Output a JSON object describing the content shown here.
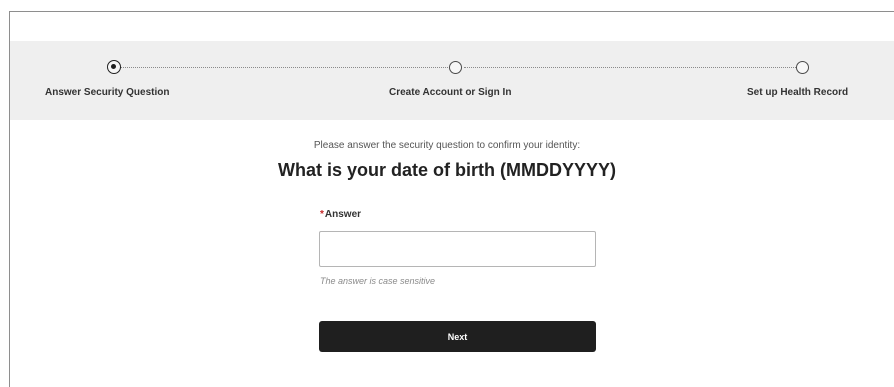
{
  "stepper": {
    "steps": [
      {
        "label": "Answer Security Question",
        "state": "active"
      },
      {
        "label": "Create Account or Sign In",
        "state": "inactive"
      },
      {
        "label": "Set up Health Record",
        "state": "inactive"
      }
    ]
  },
  "form": {
    "intro": "Please answer the security question to confirm your identity:",
    "question": "What is your date of birth (MMDDYYYY)",
    "answer_required_mark": "*",
    "answer_label": "Answer",
    "answer_value": "",
    "answer_placeholder": "",
    "hint": "The answer is case sensitive",
    "next_label": "Next"
  },
  "colors": {
    "required": "#c62828",
    "button_bg": "#1f1f1f",
    "stepper_bg": "#efefef"
  }
}
